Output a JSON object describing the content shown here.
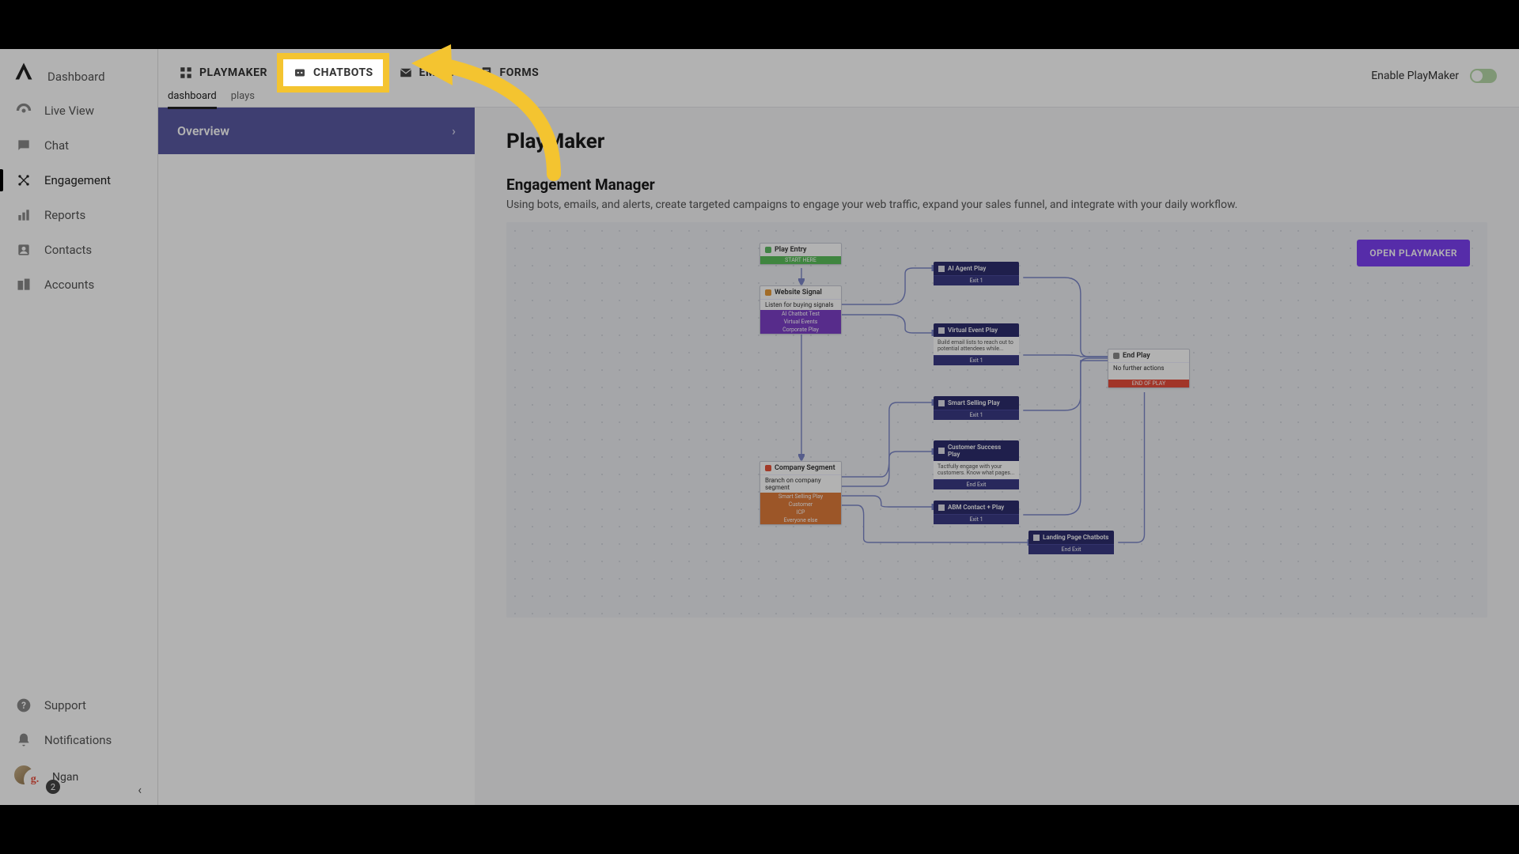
{
  "sidebar": {
    "items": [
      {
        "label": "Dashboard"
      },
      {
        "label": "Live View"
      },
      {
        "label": "Chat"
      },
      {
        "label": "Engagement"
      },
      {
        "label": "Reports"
      },
      {
        "label": "Contacts"
      },
      {
        "label": "Accounts"
      }
    ],
    "bottom": {
      "support": "Support",
      "notifications": "Notifications"
    },
    "user": {
      "name": "Ngan",
      "initial": "g.",
      "badge": "2"
    }
  },
  "topbar": {
    "tabs": [
      {
        "label": "PLAYMAKER"
      },
      {
        "label": "CHATBOTS"
      },
      {
        "label": "EMAIL"
      },
      {
        "label": "FORMS"
      }
    ],
    "subtabs": [
      {
        "label": "dashboard"
      },
      {
        "label": "plays"
      }
    ],
    "enable_label": "Enable PlayMaker"
  },
  "subpanel": {
    "overview": "Overview"
  },
  "page": {
    "title": "PlayMaker",
    "section_title": "Engagement Manager",
    "section_desc": "Using bots, emails, and alerts, create targeted campaigns to engage your web traffic, expand your sales funnel, and integrate with your daily workflow.",
    "open_button": "OPEN PLAYMAKER"
  },
  "flow": {
    "play_entry": {
      "title": "Play Entry",
      "start": "START HERE"
    },
    "website_signal": {
      "title": "Website Signal",
      "sub": "Listen for buying signals",
      "rows": [
        "AI Chatbot Test",
        "Virtual Events",
        "Corporate Play"
      ]
    },
    "company_segment": {
      "title": "Company Segment",
      "sub": "Branch on company segment",
      "rows": [
        "Smart Selling Play",
        "Customer",
        "ICP",
        "Everyone else"
      ]
    },
    "ai_agent": {
      "title": "AI Agent Play",
      "exit": "Exit 1"
    },
    "virtual_event": {
      "title": "Virtual Event Play",
      "desc": "Build email lists to reach out to potential attendees while...",
      "exit": "Exit 1"
    },
    "smart_selling": {
      "title": "Smart Selling Play",
      "exit": "Exit 1"
    },
    "customer_success": {
      "title": "Customer Success Play",
      "desc": "Tactfully engage with your customers. Know what pages...",
      "exit": "End Exit"
    },
    "abm_contact": {
      "title": "ABM Contact + Play",
      "exit": "Exit 1"
    },
    "landing_page": {
      "title": "Landing Page Chatbots",
      "exit": "End Exit"
    },
    "end_play": {
      "title": "End Play",
      "sub": "No further actions",
      "row": "END OF PLAY"
    }
  }
}
